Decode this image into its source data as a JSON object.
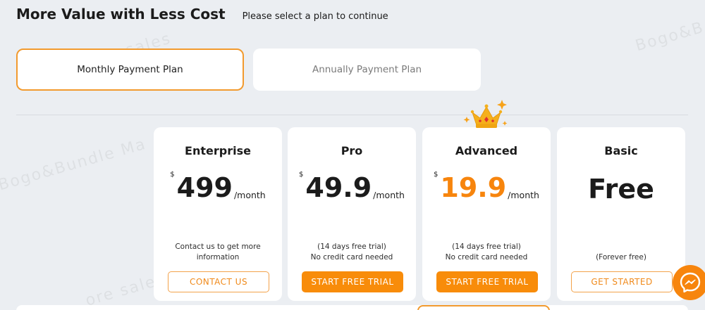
{
  "header": {
    "title": "More Value with Less Cost",
    "subtitle": "Please select a plan to continue"
  },
  "tabs": [
    {
      "label": "Monthly Payment Plan",
      "selected": true
    },
    {
      "label": "Annually Payment Plan",
      "selected": false
    }
  ],
  "watermarks": [
    "Bogo&Bundle Ma",
    "Bogo&B",
    "ore sales",
    "ore sale"
  ],
  "plans": [
    {
      "name": "Enterprise",
      "currency": "$",
      "amount": "499",
      "period": "/month",
      "note_line1": "Contact us to get more",
      "note_line2": "information",
      "button": "CONTACT US"
    },
    {
      "name": "Pro",
      "currency": "$",
      "amount": "49.9",
      "period": "/month",
      "note_line1": "(14 days free trial)",
      "note_line2": "No credit card needed",
      "button": "START FREE TRIAL"
    },
    {
      "name": "Advanced",
      "currency": "$",
      "amount": "19.9",
      "period": "/month",
      "note_line1": "(14 days free trial)",
      "note_line2": "No credit card needed",
      "button": "START FREE TRIAL",
      "badge_icon": "crown-icon"
    },
    {
      "name": "Basic",
      "amount": "Free",
      "note_line1": "(Forever free)",
      "button": "GET STARTED"
    }
  ],
  "colors": {
    "accent": "#f88c0a",
    "highlight_price": "#f7850d",
    "background": "#ebeef2"
  },
  "chat_widget": {
    "icon": "messenger-icon"
  }
}
